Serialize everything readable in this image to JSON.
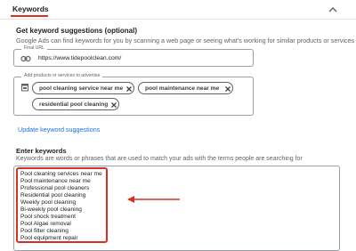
{
  "header": {
    "title": "Keywords"
  },
  "suggestions": {
    "title": "Get keyword suggestions (optional)",
    "description": "Google Ads can find keywords for you by scanning a web page or seeing what's working for similar products or services"
  },
  "url_field": {
    "label": "Final URL",
    "value": "https://www.tidepoolclean.com/",
    "icon": "link-icon"
  },
  "products_field": {
    "label": "Add products or services to advertise",
    "icon": "product-icon",
    "chips": [
      {
        "label": "pool cleaning service near me"
      },
      {
        "label": "pool maintenance near me"
      },
      {
        "label": "residential pool cleaning"
      }
    ]
  },
  "update_link": "Update keyword suggestions",
  "enter_keywords": {
    "title": "Enter keywords",
    "description": "Keywords are words or phrases that are used to match your ads with the terms people are searching for",
    "keywords": [
      "Pool cleaning services near me",
      "Pool maintenance near me",
      "Professional pool cleaners",
      "Residential pool cleaning",
      "Weekly pool cleaning",
      "Bi-weekly pool cleaning",
      "Pool shock treatment",
      "Pool Algae removal",
      "Pool filter cleaning",
      "Pool equipment repair"
    ]
  },
  "colors": {
    "highlight": "#d93025",
    "link": "#1a73e8",
    "border": "#9aa0a6"
  }
}
